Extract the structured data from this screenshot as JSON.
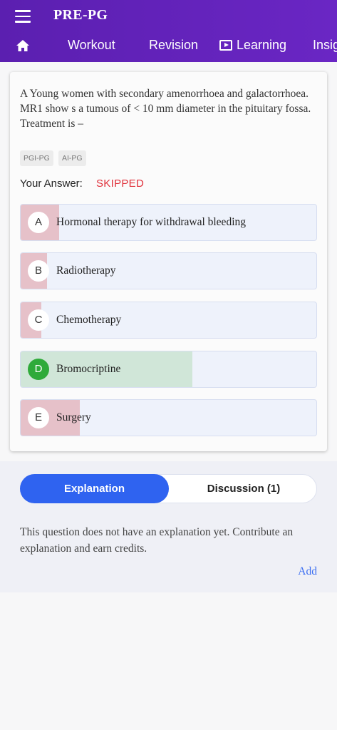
{
  "app": {
    "title": "PRE-PG"
  },
  "nav": {
    "items": [
      {
        "label": "Workout"
      },
      {
        "label": "Revision"
      },
      {
        "label": "Learning"
      },
      {
        "label": "Insig"
      }
    ]
  },
  "question": {
    "text": "A Young women with secondary amenorrhoea and galactorrhoea. MR1 show s a tumous of < 10 mm diameter in the pituitary fossa. Treatment is –",
    "tags": [
      "PGI-PG",
      "AI-PG"
    ],
    "your_answer_label": "Your Answer:",
    "your_answer_value": "SKIPPED"
  },
  "options": [
    {
      "letter": "A",
      "text": "Hormonal therapy for withdrawal bleeding",
      "response_share": 0.13,
      "status": "incorrect"
    },
    {
      "letter": "B",
      "text": "Radiotherapy",
      "response_share": 0.09,
      "status": "incorrect"
    },
    {
      "letter": "C",
      "text": "Chemotherapy",
      "response_share": 0.07,
      "status": "incorrect"
    },
    {
      "letter": "D",
      "text": "Bromocriptine",
      "response_share": 0.58,
      "status": "correct"
    },
    {
      "letter": "E",
      "text": "Surgery",
      "response_share": 0.2,
      "status": "incorrect"
    }
  ],
  "tabs": {
    "explanation": "Explanation",
    "discussion": "Discussion (1)"
  },
  "explanation": {
    "text": "This question does not have an explanation yet. Contribute an explanation and earn credits.",
    "add_label": "Add"
  },
  "colors": {
    "header": "#5b1fb0",
    "incorrect_fill": "#e6c1c9",
    "correct_fill": "#d0e6d8",
    "correct_badge": "#2faa3a",
    "skipped": "#e0303a",
    "tab_active": "#2f63f0",
    "link": "#3b6ef2"
  }
}
